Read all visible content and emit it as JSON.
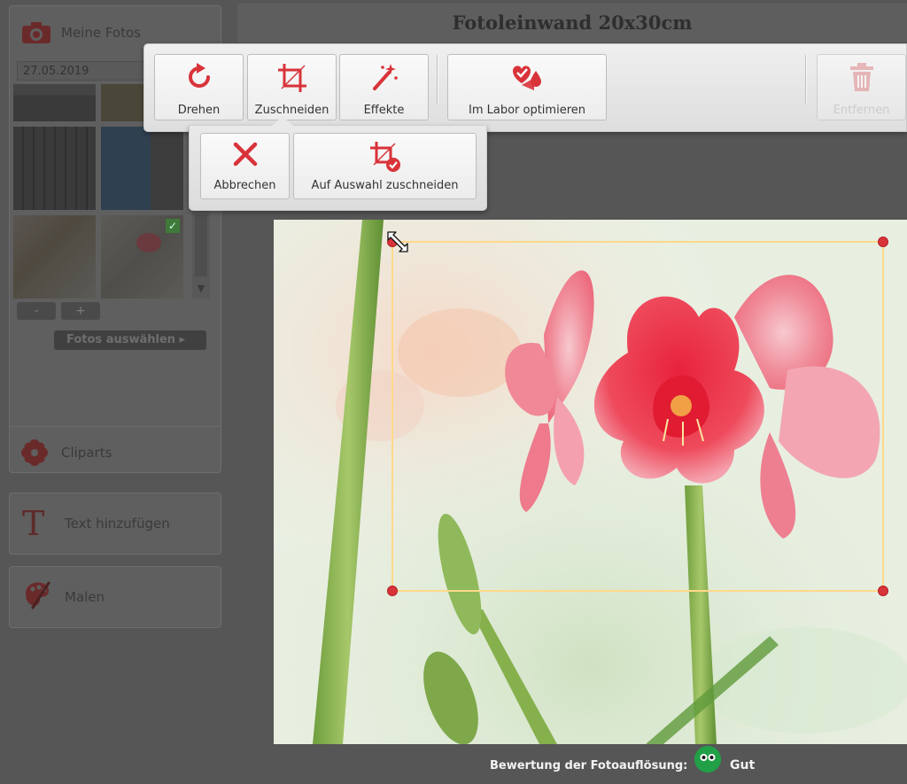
{
  "header": {
    "title": "Fotoleinwand 20x30cm"
  },
  "sidebar": {
    "photos": {
      "label": "Meine Fotos",
      "icon": "camera-icon",
      "date": "27.05.2019",
      "zoom_out": "-",
      "zoom_in": "+",
      "select_button": "Fotos auswählen ▸"
    },
    "cliparts": {
      "label": "Cliparts",
      "icon": "flower-icon"
    },
    "text": {
      "label": "Text hinzufügen",
      "icon": "text-T-icon"
    },
    "paint": {
      "label": "Malen",
      "icon": "palette-icon"
    }
  },
  "toolbar": {
    "rotate": "Drehen",
    "crop": "Zuschneiden",
    "effects": "Effekte",
    "lab_optimize": "Im Labor optimieren",
    "remove": "Entfernen"
  },
  "crop_menu": {
    "cancel": "Abbrechen",
    "apply": "Auf Auswahl zuschneiden"
  },
  "footer": {
    "resolution_label": "Bewertung der Fotoauflösung:",
    "resolution_value": "Gut"
  },
  "colors": {
    "accent": "#d9333a",
    "crop_frame": "#ffd98a",
    "rating_good": "#22a047",
    "overlay": "#565656"
  }
}
